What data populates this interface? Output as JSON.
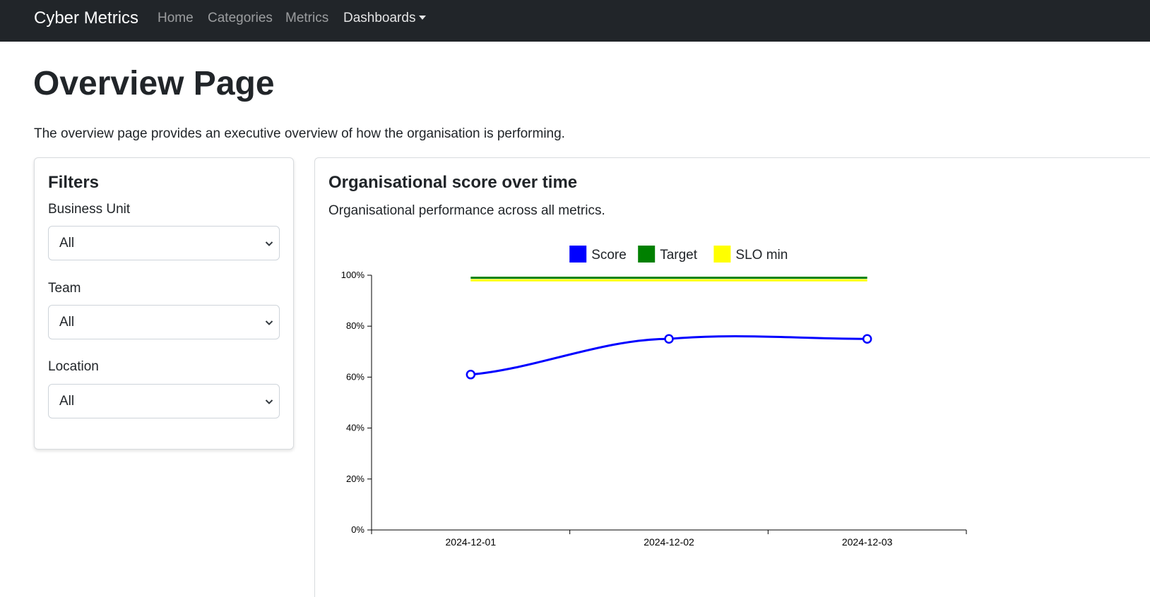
{
  "navbar": {
    "brand": "Cyber Metrics",
    "links": [
      {
        "label": "Home"
      },
      {
        "label": "Categories"
      },
      {
        "label": "Metrics"
      },
      {
        "label": "Dashboards"
      }
    ]
  },
  "page": {
    "title": "Overview Page",
    "description": "The overview page provides an executive overview of how the organisation is performing."
  },
  "filters": {
    "title": "Filters",
    "fields": [
      {
        "label": "Business Unit",
        "value": "All"
      },
      {
        "label": "Team",
        "value": "All"
      },
      {
        "label": "Location",
        "value": "All"
      }
    ]
  },
  "chart_card": {
    "title": "Organisational score over time",
    "subtitle": "Organisational performance across all metrics."
  },
  "chart_data": {
    "type": "line",
    "x": [
      "2024-12-01",
      "2024-12-02",
      "2024-12-03"
    ],
    "series": [
      {
        "name": "Score",
        "color": "#0000ff",
        "values": [
          61,
          75,
          75
        ],
        "markers": true
      },
      {
        "name": "Target",
        "color": "#008000",
        "values": [
          99,
          99,
          99
        ],
        "markers": false
      },
      {
        "name": "SLO min",
        "color": "#ffff00",
        "values": [
          98,
          98,
          98
        ],
        "markers": false
      }
    ],
    "ylim": [
      0,
      100
    ],
    "yticks": [
      "0%",
      "20%",
      "40%",
      "60%",
      "80%",
      "100%"
    ],
    "legend_position": "top-center",
    "grid": false
  }
}
